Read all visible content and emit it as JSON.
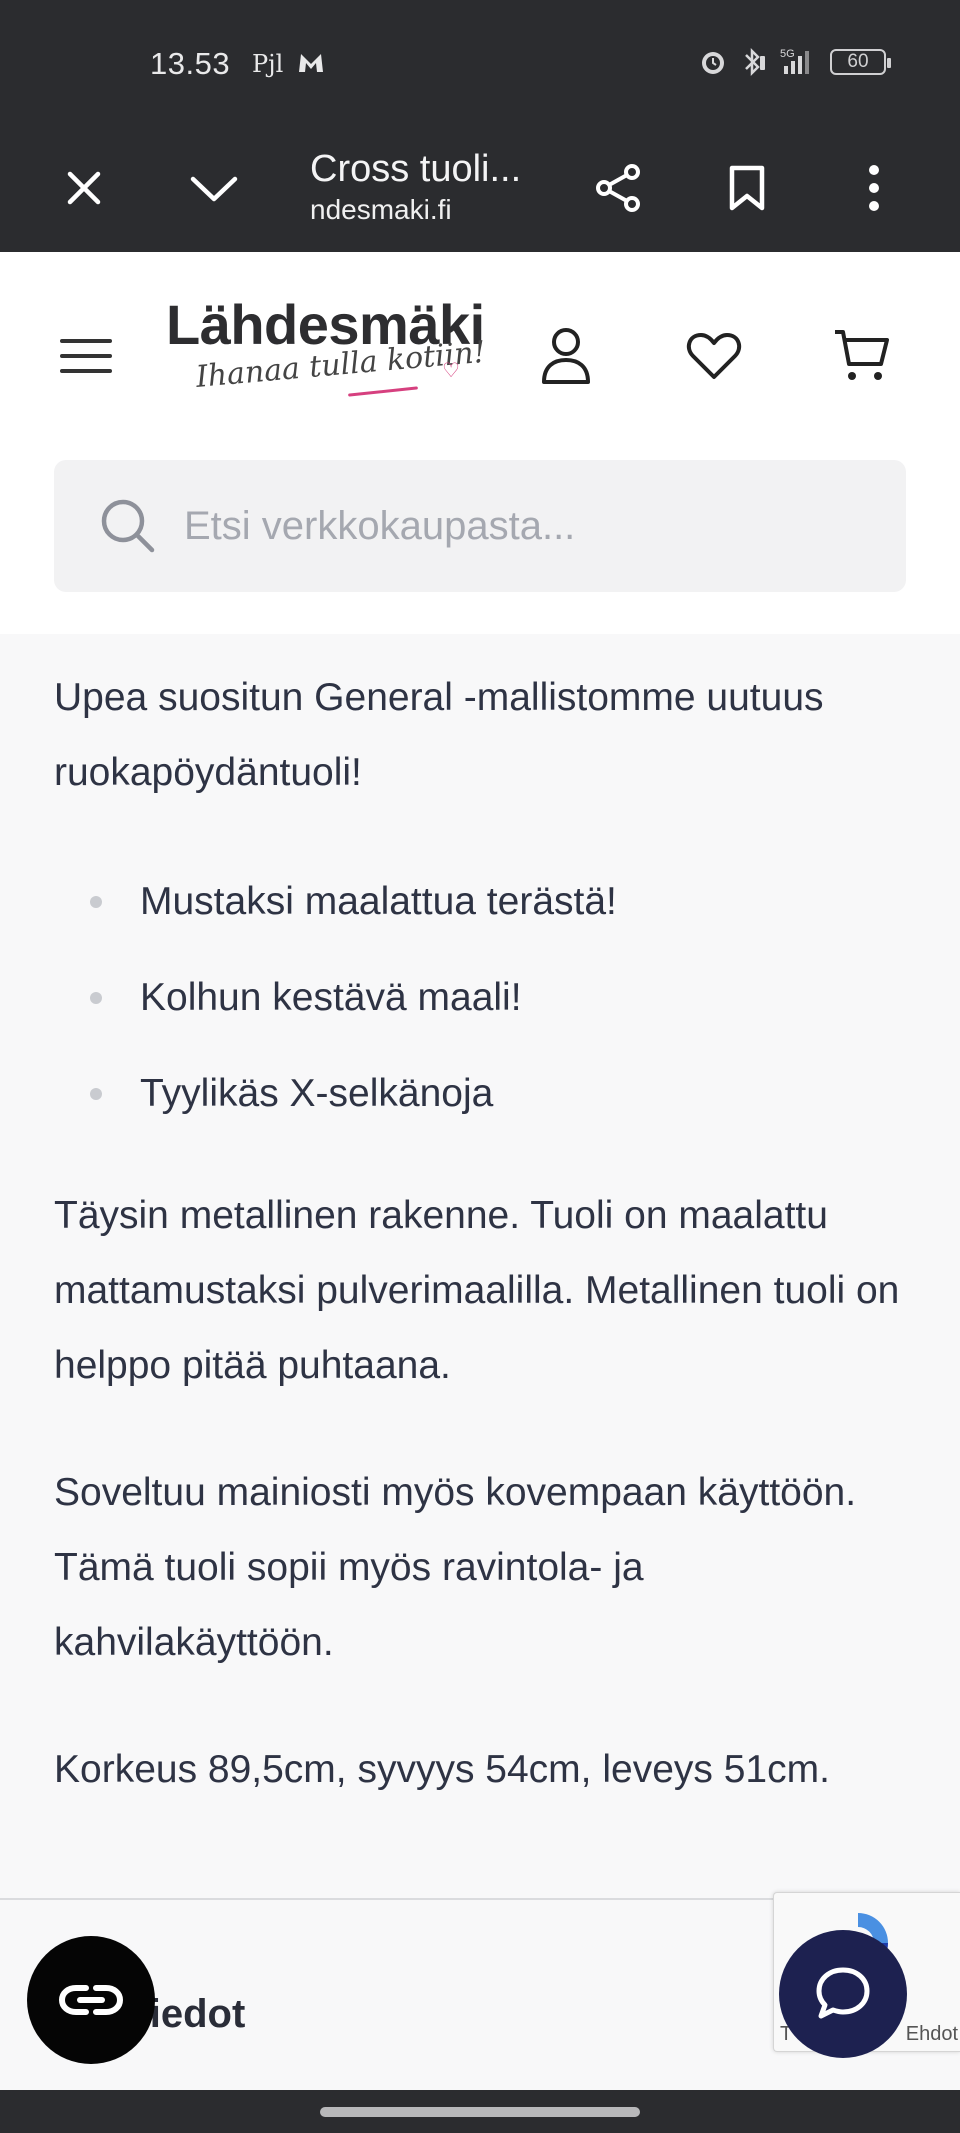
{
  "status_bar": {
    "time": "13.53",
    "carrier": "Pjl",
    "network": "5G",
    "battery": "60"
  },
  "browser": {
    "title": "Cross tuoli...",
    "url": "ndesmaki.fi",
    "icons": [
      "close-icon",
      "chevron-down-icon",
      "share-icon",
      "bookmark-icon",
      "more-vert-icon"
    ]
  },
  "site": {
    "logo_name": "Lähdesmäki",
    "logo_tagline": "Ihanaa tulla kotiin!",
    "search_placeholder": "Etsi verkkokaupasta...",
    "icons": [
      "menu-icon",
      "user-icon",
      "heart-icon",
      "cart-icon",
      "search-icon"
    ]
  },
  "description": {
    "intro": "Upea suositun General -mallistomme uutuus ruokapöydäntuoli!",
    "features": [
      "Mustaksi maalattua terästä!",
      "Kolhun kestävä maali!",
      "Tyylikäs X-selkänoja"
    ],
    "paragraph_1": "Täysin metallinen rakenne. Tuoli on maalattu mattamustaksi pulverimaalilla. Metallinen tuoli on helppo pitää puhtaana.",
    "paragraph_2": "Soveltuu mainiosti myös kovempaan käyttöön. Tämä tuoli sopii myös ravintola- ja kahvilakäyttöön.",
    "dimensions": "Korkeus 89,5cm, syvyys 54cm, leveys 51cm."
  },
  "info_section": {
    "heading": "Tiedot"
  },
  "recaptcha": {
    "link_left": "T",
    "link_right": "Ehdot"
  },
  "colors": {
    "bar_dark": "#2b2c2f",
    "chat_button": "#1d2150",
    "accent_pink": "#d6407f"
  }
}
